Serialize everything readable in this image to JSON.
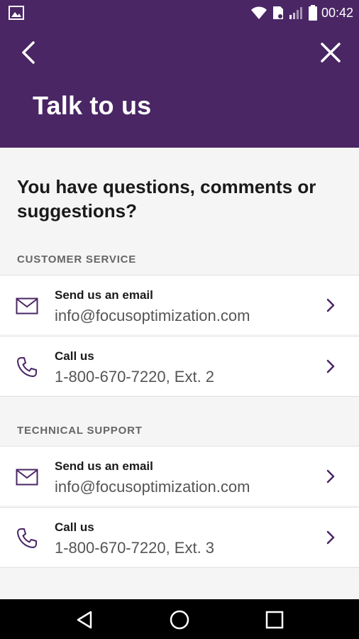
{
  "status_bar": {
    "time": "00:42",
    "icons": [
      "gallery-icon",
      "wifi-icon",
      "sim-icon",
      "signal-icon",
      "battery-icon"
    ]
  },
  "app_bar": {
    "title": "Talk to us",
    "icons": [
      "back-arrow-icon",
      "close-icon"
    ]
  },
  "headline": "You have questions, comments or suggestions?",
  "sections": [
    {
      "label": "CUSTOMER SERVICE",
      "items": [
        {
          "title": "Send us an email",
          "value": "info@focusoptimization.com",
          "icon": "mail-icon"
        },
        {
          "title": "Call us",
          "value": "1-800-670-7220, Ext. 2",
          "icon": "phone-icon"
        }
      ]
    },
    {
      "label": "TECHNICAL SUPPORT",
      "items": [
        {
          "title": "Send us an email",
          "value": "info@focusoptimization.com",
          "icon": "mail-icon"
        },
        {
          "title": "Call us",
          "value": "1-800-670-7220, Ext. 3",
          "icon": "phone-icon"
        }
      ]
    }
  ],
  "colors": {
    "primary": "#4a2665",
    "icon_accent": "#4a2665",
    "background": "#f5f5f5"
  },
  "nav_bar": {
    "icons": [
      "back-triangle-icon",
      "home-circle-icon",
      "recents-square-icon"
    ]
  }
}
